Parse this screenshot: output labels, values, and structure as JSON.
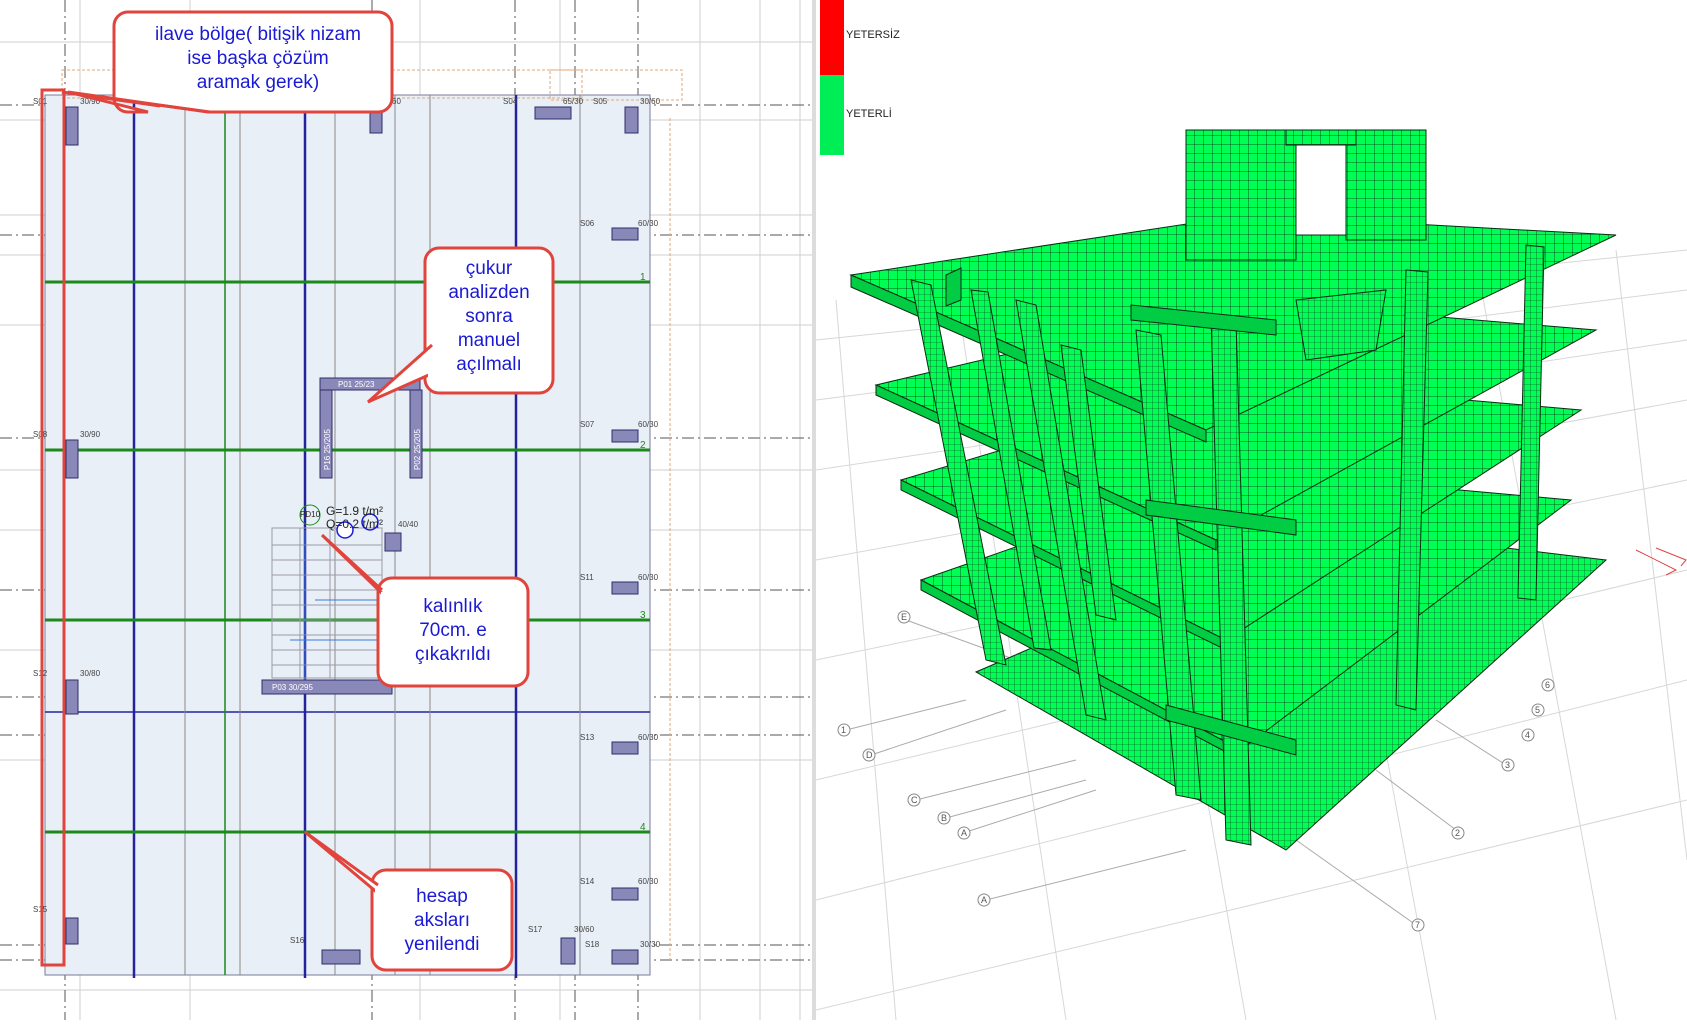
{
  "colors": {
    "slab_fill": "#e9eff6",
    "axis_green": "#1b8a1b",
    "axis_blue": "#23239c",
    "callout_border": "#e0443c",
    "callout_text": "#1a1ad6",
    "column_fill": "#8a88b8",
    "model_green": "#00ff55",
    "legend_red": "#ff0000",
    "legend_green": "#00ee55"
  },
  "callouts": {
    "ilave": {
      "lines": [
        "ilave bölge( bitişik nizam",
        "ise başka çözüm",
        "aramak gerek)"
      ]
    },
    "cukur": {
      "lines": [
        "çukur",
        "analizden",
        "sonra",
        "manuel",
        "açılmalı"
      ]
    },
    "kalinlik": {
      "lines": [
        "kalınlık",
        "70cm. e",
        "çıkakrıldı"
      ]
    },
    "hesap": {
      "lines": [
        "hesap",
        "aksları",
        "yenilendi"
      ]
    }
  },
  "plan": {
    "columns": [
      {
        "label": "S01",
        "size": "30/90"
      },
      {
        "label": "60",
        "size": ""
      },
      {
        "label": "S04",
        "size": "65/30"
      },
      {
        "label": "S05",
        "size": "30/60"
      },
      {
        "label": "S06",
        "size": "60/30"
      },
      {
        "label": "S08",
        "size": "30/90"
      },
      {
        "label": "S07",
        "size": "60/30"
      },
      {
        "label": "S11",
        "size": "60/30"
      },
      {
        "label": "S12",
        "size": "30/80"
      },
      {
        "label": "S13",
        "size": "60/30"
      },
      {
        "label": "S14",
        "size": "60/30"
      },
      {
        "label": "S15",
        "size": ""
      },
      {
        "label": "S16",
        "size": ""
      },
      {
        "label": "S17",
        "size": "30/60"
      },
      {
        "label": "S18",
        "size": "30/30"
      }
    ],
    "axis_numbers": [
      "1",
      "2",
      "3",
      "4"
    ],
    "walls": {
      "p01": "P01 25/23",
      "p16": "P16 25/205",
      "p02": "P02 25/205",
      "p03": "P03 30/295"
    },
    "load_text": {
      "g": "G=1.9 t/m²",
      "q": "Q=0.2 t/m²",
      "size": "40/40",
      "pd": "PD10"
    }
  },
  "legend": {
    "items": [
      {
        "label": "YETERSİZ",
        "color": "#ff0000",
        "fraction": 0.5
      },
      {
        "label": "YETERLİ",
        "color": "#00ee55",
        "fraction": 0.5
      }
    ]
  },
  "model_axes": [
    "1",
    "2",
    "3",
    "4",
    "5",
    "6",
    "7",
    "A",
    "B",
    "C",
    "D",
    "E"
  ]
}
